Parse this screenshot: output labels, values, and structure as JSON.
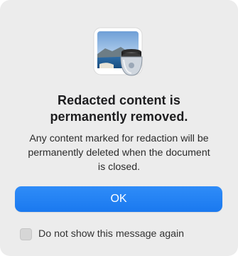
{
  "dialog": {
    "app_icon": "preview-app-icon",
    "title_line1": "Redacted content is",
    "title_line2": "permanently removed.",
    "message_line1": "Any content marked for redaction will be",
    "message_line2": "permanently deleted when the document",
    "message_line3": "is closed.",
    "ok_label": "OK",
    "checkbox": {
      "checked": false,
      "label": "Do not show this message again"
    }
  },
  "colors": {
    "background": "#ececec",
    "accent": "#1f7ff2"
  }
}
